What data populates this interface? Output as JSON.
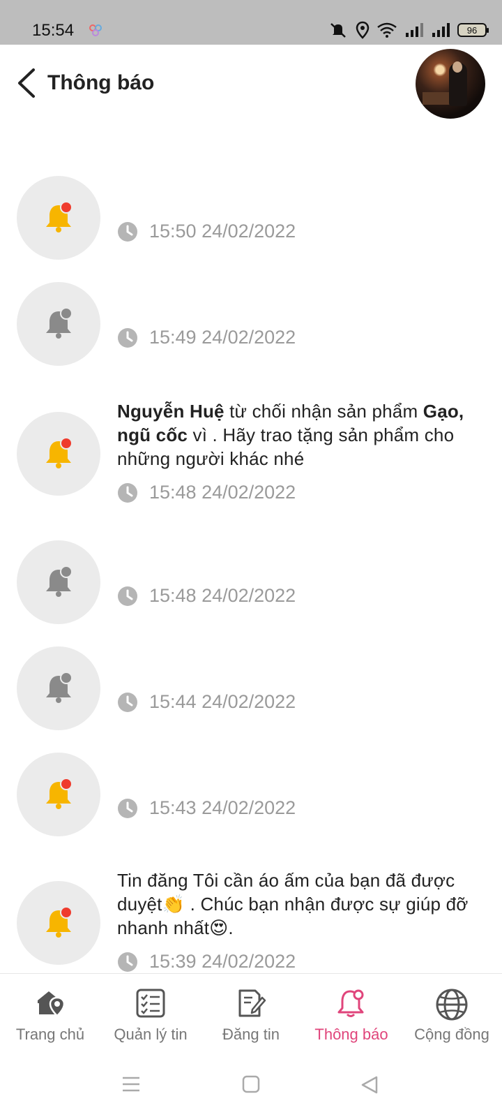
{
  "status_bar": {
    "time": "15:54",
    "battery": "96"
  },
  "header": {
    "title": "Thông báo"
  },
  "notifications": [
    {
      "state": "unread",
      "message_parts": [],
      "time": "15:50 24/02/2022"
    },
    {
      "state": "read",
      "message_parts": [],
      "time": "15:49 24/02/2022"
    },
    {
      "state": "unread",
      "message_parts": [
        {
          "text": "Nguyễn Huệ",
          "bold": true
        },
        {
          "text": " từ chối nhận sản phẩm ",
          "bold": false
        },
        {
          "text": "Gạo, ngũ cốc",
          "bold": true
        },
        {
          "text": " vì . Hãy trao tặng sản phẩm cho những người khác nhé",
          "bold": false
        }
      ],
      "time": "15:48 24/02/2022"
    },
    {
      "state": "read",
      "message_parts": [],
      "time": "15:48 24/02/2022"
    },
    {
      "state": "read",
      "message_parts": [],
      "time": "15:44 24/02/2022"
    },
    {
      "state": "unread",
      "message_parts": [],
      "time": "15:43 24/02/2022"
    },
    {
      "state": "unread",
      "message_parts": [
        {
          "text": "Tin đăng Tôi cần áo ấm của bạn đã được duyệt👏 . Chúc bạn nhận được sự giúp đỡ nhanh nhất😍.",
          "bold": false
        }
      ],
      "time": "15:39 24/02/2022"
    }
  ],
  "bottom_nav": [
    {
      "label": "Trang chủ",
      "icon": "home-location-icon",
      "active": false
    },
    {
      "label": "Quản lý tin",
      "icon": "checklist-icon",
      "active": false
    },
    {
      "label": "Đăng tin",
      "icon": "edit-document-icon",
      "active": false
    },
    {
      "label": "Thông báo",
      "icon": "bell-icon",
      "active": true
    },
    {
      "label": "Cộng đồng",
      "icon": "globe-icon",
      "active": false
    }
  ],
  "colors": {
    "accent": "#e0457b",
    "bell_unread": "#f7b500",
    "badge": "#ef3b2d",
    "bell_read": "#8a8a8a",
    "bubble": "#ebebeb"
  }
}
